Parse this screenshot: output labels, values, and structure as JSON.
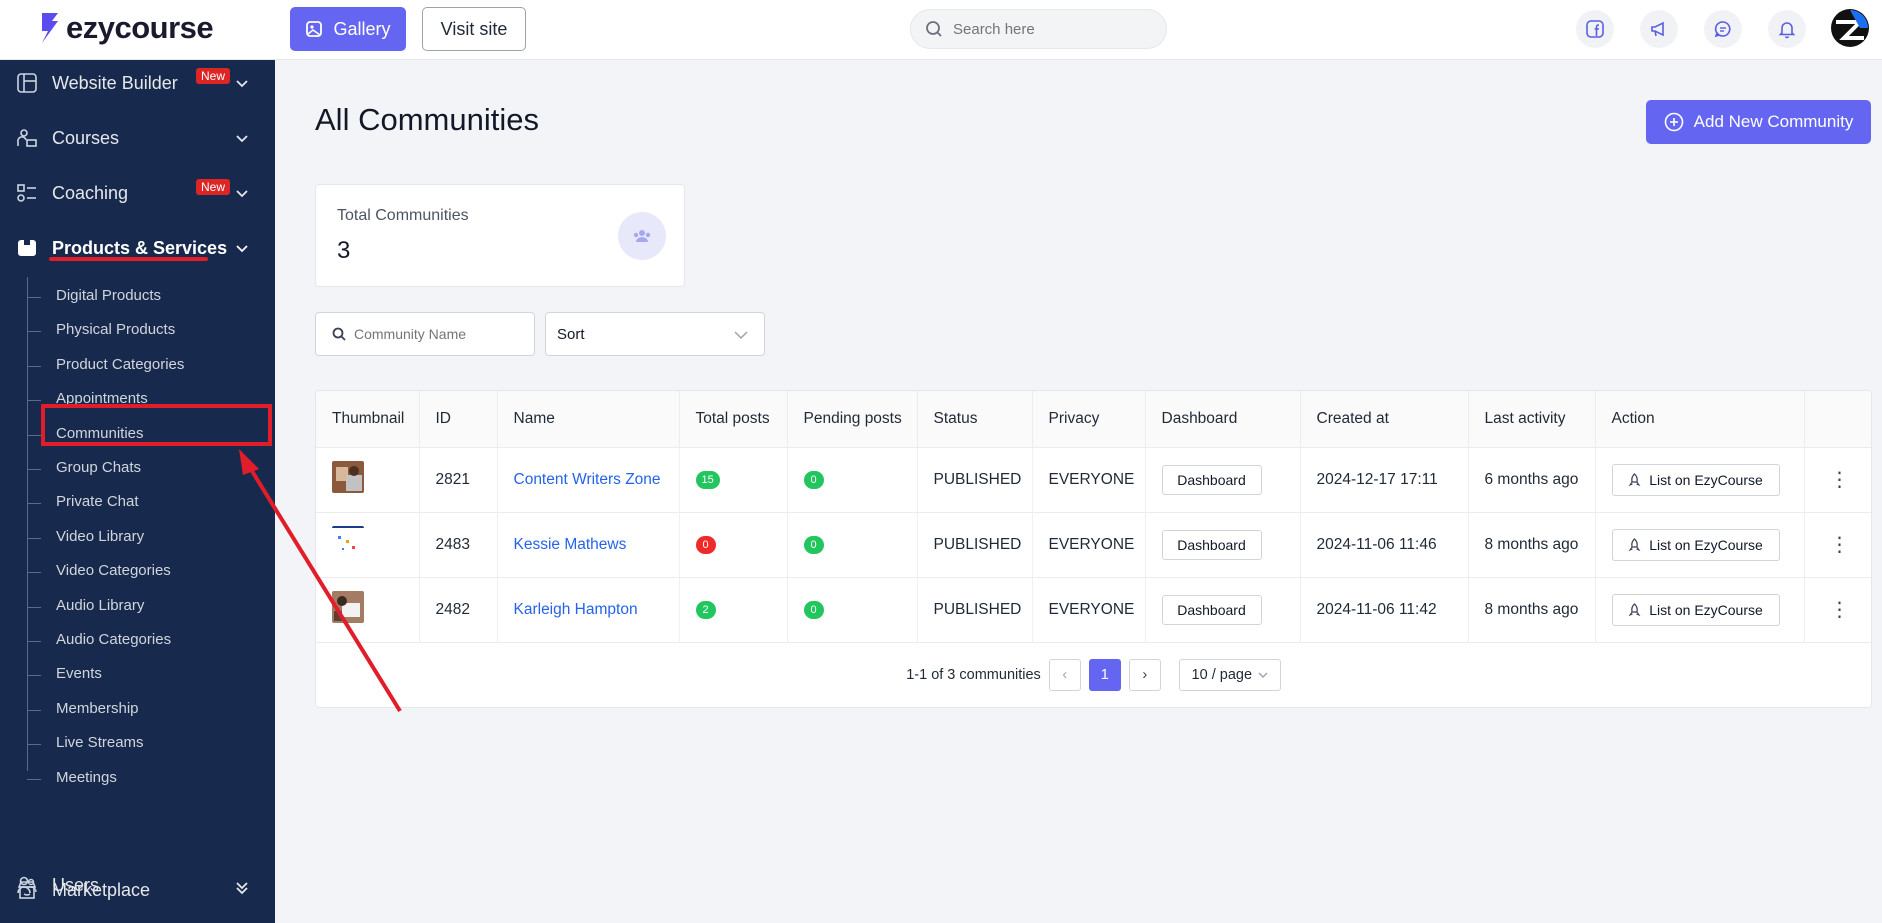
{
  "brand": {
    "name": "ezycourse"
  },
  "topbar": {
    "gallery_label": "Gallery",
    "visit_label": "Visit site",
    "search_placeholder": "Search here"
  },
  "sidebar": {
    "items": [
      {
        "label": "Website Builder",
        "badge": "New",
        "icon": "layout-icon"
      },
      {
        "label": "Courses",
        "icon": "courses-icon"
      },
      {
        "label": "Coaching",
        "badge": "New",
        "icon": "coaching-icon"
      },
      {
        "label": "Products & Services",
        "icon": "box-icon",
        "active": true
      },
      {
        "label": "Marketplace",
        "icon": "store-icon"
      },
      {
        "label": "Users",
        "icon": "users-icon"
      }
    ],
    "sub_items": [
      "Digital Products",
      "Physical Products",
      "Product Categories",
      "Appointments",
      "Communities",
      "Group Chats",
      "Private Chat",
      "Video Library",
      "Video Categories",
      "Audio Library",
      "Audio Categories",
      "Events",
      "Membership",
      "Live Streams",
      "Meetings"
    ]
  },
  "main": {
    "title": "All Communities",
    "add_button": "Add New Community",
    "stat": {
      "label": "Total Communities",
      "value": "3"
    },
    "filter": {
      "placeholder": "Community Name",
      "sort_label": "Sort"
    },
    "columns": [
      "Thumbnail",
      "ID",
      "Name",
      "Total posts",
      "Pending posts",
      "Status",
      "Privacy",
      "Dashboard",
      "Created at",
      "Last activity",
      "Action"
    ],
    "rows": [
      {
        "id": "2821",
        "name": "Content Writers Zone",
        "total_posts": "15",
        "pending_posts": "0",
        "status": "PUBLISHED",
        "privacy": "EVERYONE",
        "dashboard": "Dashboard",
        "created_at": "2024-12-17 17:11",
        "last_activity": "6 months ago",
        "action": "List on EzyCourse"
      },
      {
        "id": "2483",
        "name": "Kessie Mathews",
        "total_posts": "0",
        "pending_posts": "0",
        "status": "PUBLISHED",
        "privacy": "EVERYONE",
        "dashboard": "Dashboard",
        "created_at": "2024-11-06 11:46",
        "last_activity": "8 months ago",
        "action": "List on EzyCourse"
      },
      {
        "id": "2482",
        "name": "Karleigh Hampton",
        "total_posts": "2",
        "pending_posts": "0",
        "status": "PUBLISHED",
        "privacy": "EVERYONE",
        "dashboard": "Dashboard",
        "created_at": "2024-11-06 11:42",
        "last_activity": "8 months ago",
        "action": "List on EzyCourse"
      }
    ],
    "pagination": {
      "summary": "1-1 of 3 communities",
      "current": "1",
      "page_size": "10 / page"
    }
  },
  "colors": {
    "accent": "#6466f1",
    "sidebar": "#172a4d",
    "annotation": "#e11d2a",
    "link": "#2563eb"
  }
}
